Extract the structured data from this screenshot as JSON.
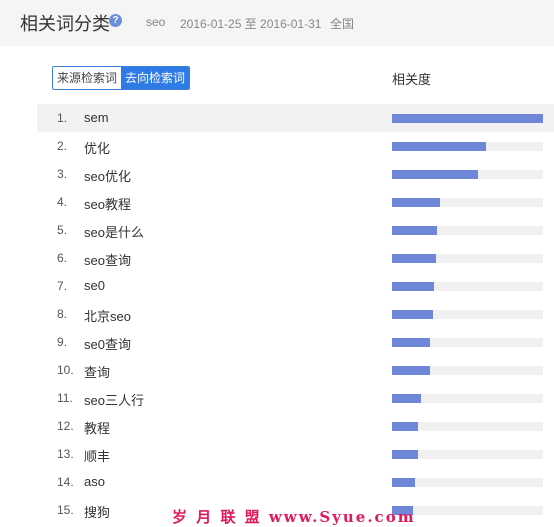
{
  "header": {
    "title": "相关词分类",
    "keyword": "seo",
    "date_range": "2016-01-25 至 2016-01-31",
    "region": "全国"
  },
  "tabs": [
    {
      "label": "来源检索词",
      "active": false
    },
    {
      "label": "去向检索词",
      "active": true
    }
  ],
  "column_header": "相关度",
  "rows": [
    {
      "rank": "1.",
      "keyword": "sem",
      "relevance": 1.0
    },
    {
      "rank": "2.",
      "keyword": "优化",
      "relevance": 0.62
    },
    {
      "rank": "3.",
      "keyword": "seo优化",
      "relevance": 0.57
    },
    {
      "rank": "4.",
      "keyword": "seo教程",
      "relevance": 0.32
    },
    {
      "rank": "5.",
      "keyword": "seo是什么",
      "relevance": 0.3
    },
    {
      "rank": "6.",
      "keyword": "seo查询",
      "relevance": 0.29
    },
    {
      "rank": "7.",
      "keyword": "se0",
      "relevance": 0.28
    },
    {
      "rank": "8.",
      "keyword": "北京seo",
      "relevance": 0.27
    },
    {
      "rank": "9.",
      "keyword": "se0查询",
      "relevance": 0.25
    },
    {
      "rank": "10.",
      "keyword": "查询",
      "relevance": 0.25
    },
    {
      "rank": "11.",
      "keyword": "seo三人行",
      "relevance": 0.19
    },
    {
      "rank": "12.",
      "keyword": "教程",
      "relevance": 0.17
    },
    {
      "rank": "13.",
      "keyword": "顺丰",
      "relevance": 0.17
    },
    {
      "rank": "14.",
      "keyword": "aso",
      "relevance": 0.15
    },
    {
      "rank": "15.",
      "keyword": "搜狗",
      "relevance": 0.14
    }
  ],
  "colors": {
    "bar": "#6f87d9",
    "tab_active": "#2f7be6",
    "highlight_row": "#f2f2f2",
    "watermark": "#e0185c"
  },
  "watermark": "岁 月 联 盟  www.Syue.com"
}
